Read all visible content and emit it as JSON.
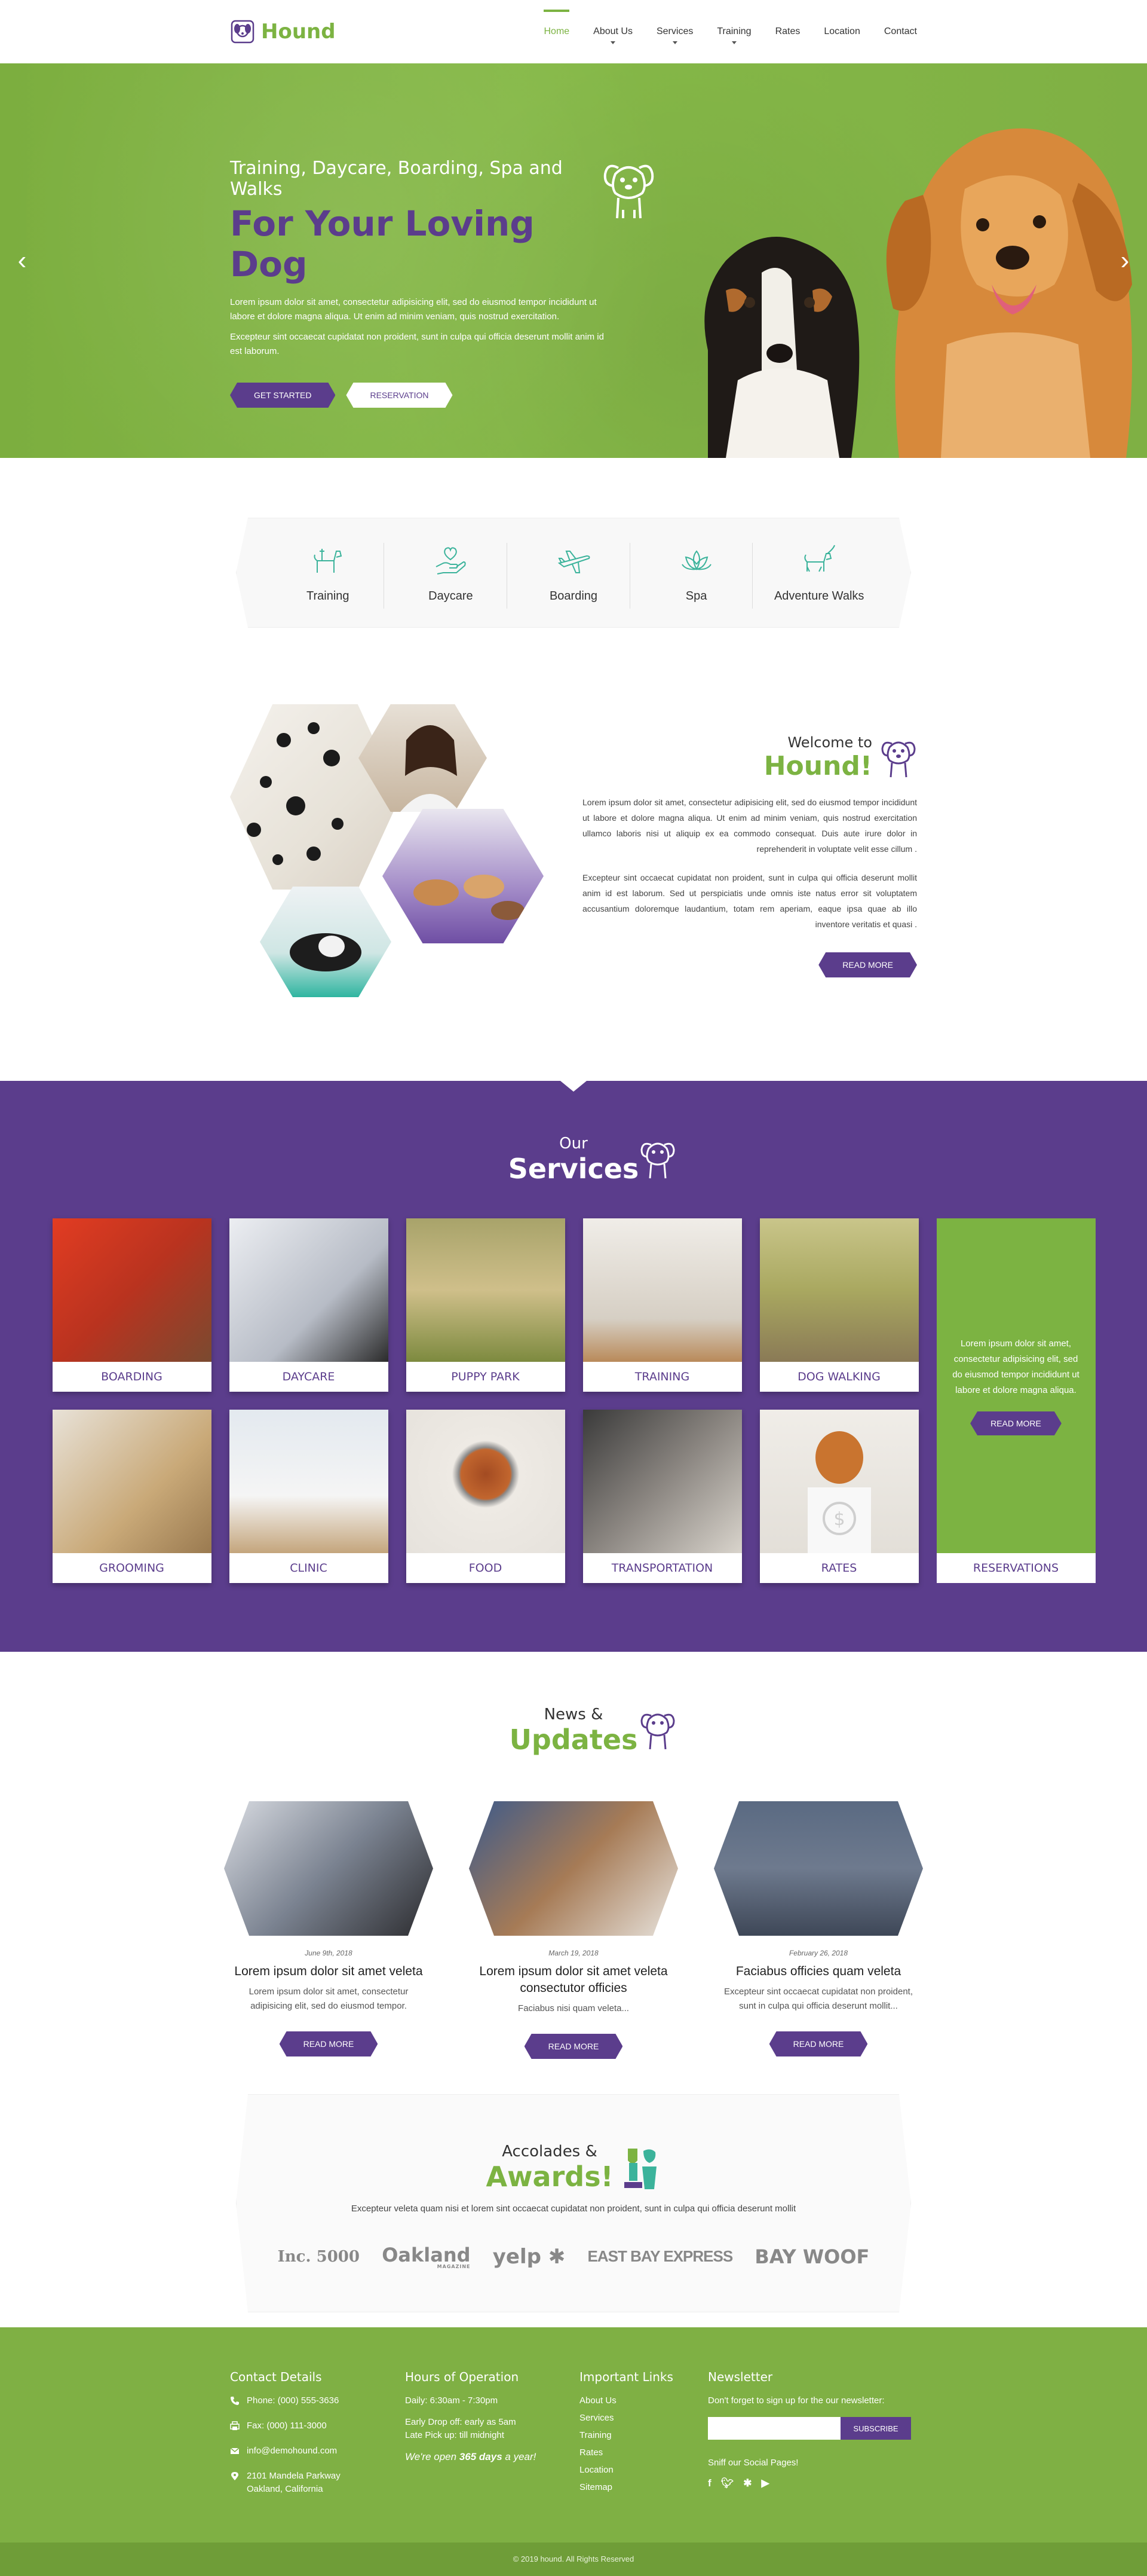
{
  "header": {
    "logo_text": "Hound",
    "nav": [
      {
        "label": "Home",
        "active": true,
        "dropdown": false
      },
      {
        "label": "About Us",
        "active": false,
        "dropdown": true
      },
      {
        "label": "Services",
        "active": false,
        "dropdown": true
      },
      {
        "label": "Training",
        "active": false,
        "dropdown": true
      },
      {
        "label": "Rates",
        "active": false,
        "dropdown": false
      },
      {
        "label": "Location",
        "active": false,
        "dropdown": false
      },
      {
        "label": "Contact",
        "active": false,
        "dropdown": false
      }
    ]
  },
  "hero": {
    "subtitle": "Training, Daycare, Boarding, Spa and Walks",
    "title": "For Your Loving Dog",
    "p1": "Lorem ipsum dolor sit amet, consectetur adipisicing elit, sed do eiusmod tempor incididunt ut labore et dolore magna aliqua. Ut enim ad minim veniam, quis nostrud exercitation.",
    "p2": "Excepteur sint occaecat cupidatat non proident, sunt in culpa qui officia deserunt mollit anim id est laborum.",
    "btn_primary": "GET STARTED",
    "btn_secondary": "RESERVATION",
    "prev_icon": "chevron-left",
    "next_icon": "chevron-right"
  },
  "features": [
    {
      "label": "Training",
      "icon": "dog-training-icon"
    },
    {
      "label": "Daycare",
      "icon": "hand-heart-icon"
    },
    {
      "label": "Boarding",
      "icon": "airplane-icon"
    },
    {
      "label": "Spa",
      "icon": "lotus-icon"
    },
    {
      "label": "Adventure Walks",
      "icon": "dog-walk-icon"
    }
  ],
  "welcome": {
    "small": "Welcome to",
    "big": "Hound!",
    "p1": "Lorem ipsum dolor sit amet, consectetur adipisicing elit, sed do eiusmod tempor incididunt ut labore et dolore magna aliqua. Ut enim ad minim veniam, quis nostrud exercitation ullamco laboris nisi ut aliquip ex ea commodo consequat. Duis aute irure dolor in reprehenderit in voluptate velit esse cillum .",
    "p2": "Excepteur sint occaecat cupidatat non proident, sunt in culpa qui officia deserunt mollit anim id est laborum. Sed ut perspiciatis unde omnis iste natus error sit voluptatem accusantium doloremque laudantium, totam rem aperiam, eaque ipsa quae ab illo inventore veritatis et quasi .",
    "btn": "READ MORE"
  },
  "services": {
    "small": "Our",
    "big": "Services",
    "items": [
      {
        "label": "BOARDING",
        "color": "#d94a2e"
      },
      {
        "label": "DAYCARE",
        "color": "#c9ccd4"
      },
      {
        "label": "PUPPY PARK",
        "color": "#9f9b58"
      },
      {
        "label": "TRAINING",
        "color": "#d8d3ca"
      },
      {
        "label": "DOG WALKING",
        "color": "#b3b26b"
      },
      {
        "label": "GROOMING",
        "color": "#c8b79f"
      },
      {
        "label": "CLINIC",
        "color": "#d6dde6"
      },
      {
        "label": "FOOD",
        "color": "#e6e2dc"
      },
      {
        "label": "TRANSPORTATION",
        "color": "#7a756f"
      },
      {
        "label": "RATES",
        "color": "#d9d4cc"
      }
    ],
    "promo_text": "Lorem ipsum dolor sit amet, consectetur adipisicing elit, sed do eiusmod tempor incididunt ut labore et dolore magna aliqua.",
    "promo_btn": "READ MORE",
    "promo_label": "RESERVATIONS"
  },
  "news": {
    "small": "News &",
    "big": "Updates",
    "items": [
      {
        "date": "June 9th, 2018",
        "title": "Lorem ipsum dolor sit amet veleta",
        "text": "Lorem ipsum dolor sit amet, consectetur adipisicing elit, sed do eiusmod tempor.",
        "btn": "READ MORE"
      },
      {
        "date": "March 19, 2018",
        "title": "Lorem ipsum dolor sit amet veleta consectutor officies",
        "text": "Faciabus nisi quam veleta...",
        "btn": "READ MORE"
      },
      {
        "date": "February 26, 2018",
        "title": "Faciabus officies quam veleta",
        "text": "Excepteur sint occaecat cupidatat non proident, sunt in culpa qui officia deserunt mollit...",
        "btn": "READ MORE"
      }
    ]
  },
  "awards": {
    "small": "Accolades &",
    "big": "Awards!",
    "text": "Excepteur veleta quam nisi et lorem sint occaecat cupidatat non proident, sunt in culpa qui officia deserunt mollit",
    "logos": [
      "Inc. 5000",
      "Oakland",
      "yelp",
      "EAST BAY EXPRESS",
      "BAY WOOF"
    ],
    "oakland_sub": "MAGAZINE"
  },
  "footer": {
    "contact": {
      "title": "Contact Details",
      "phone": "Phone: (000) 555-3636",
      "fax": "Fax: (000) 111-3000",
      "email": "info@demohound.com",
      "address1": "2101 Mandela Parkway",
      "address2": "Oakland, California"
    },
    "hours": {
      "title": "Hours of Operation",
      "daily": "Daily: 6:30am - 7:30pm",
      "early": "Early Drop off: early as 5am",
      "late": "Late Pick up: till midnight",
      "open_prefix": "We're open ",
      "open_days": "365 days",
      "open_suffix": " a year!"
    },
    "links": {
      "title": "Important Links",
      "items": [
        "About Us",
        "Services",
        "Training",
        "Rates",
        "Location",
        "Sitemap"
      ]
    },
    "newsletter": {
      "title": "Newsletter",
      "text": "Don't forget to sign up for the our newsletter:",
      "placeholder": "",
      "btn": "SUBSCRIBE",
      "social_title": "Sniff our Social Pages!",
      "socials": [
        "facebook-icon",
        "twitter-icon",
        "yelp-icon",
        "youtube-icon"
      ]
    },
    "copyright": "© 2019 hound. All Rights Reserved"
  },
  "colors": {
    "green": "#7cb342",
    "purple": "#5b3d8c"
  }
}
